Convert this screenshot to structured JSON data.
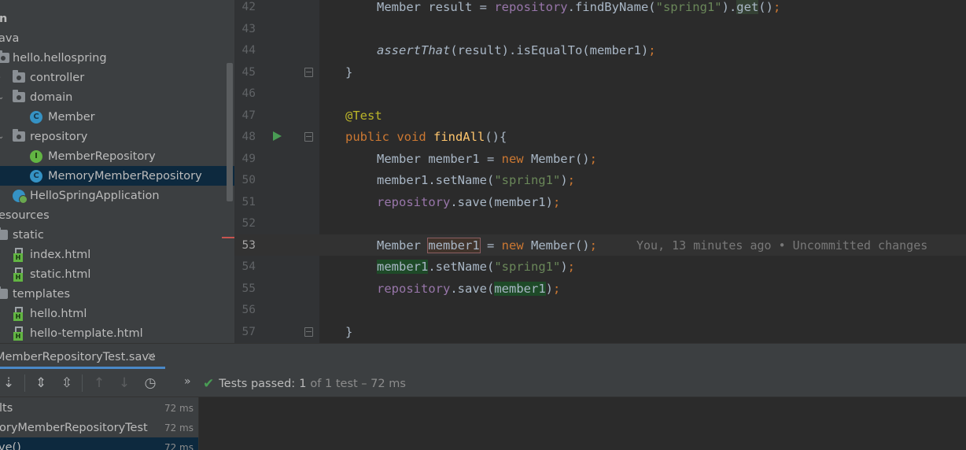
{
  "project_tree": {
    "items": [
      {
        "label": "n",
        "icon": "none"
      },
      {
        "label": "ava",
        "icon": "none"
      },
      {
        "label": "hello.hellospring",
        "icon": "package-icon"
      },
      {
        "label": "controller",
        "icon": "package-icon"
      },
      {
        "label": "domain",
        "icon": "package-icon"
      },
      {
        "label": "Member",
        "icon": "class-icon",
        "badge": "C"
      },
      {
        "label": "repository",
        "icon": "package-icon"
      },
      {
        "label": "MemberRepository",
        "icon": "interface-icon",
        "badge": "I"
      },
      {
        "label": "MemoryMemberRepository",
        "icon": "class-icon",
        "badge": "C",
        "selected": true
      },
      {
        "label": "HelloSpringApplication",
        "icon": "spring-boot-app-icon"
      },
      {
        "label": "esources",
        "icon": "none"
      },
      {
        "label": "static",
        "icon": "folder-icon"
      },
      {
        "label": "index.html",
        "icon": "html-file-icon",
        "badge": "H"
      },
      {
        "label": "static.html",
        "icon": "html-file-icon",
        "badge": "H"
      },
      {
        "label": "templates",
        "icon": "folder-icon"
      },
      {
        "label": "hello.html",
        "icon": "html-file-icon",
        "badge": "H"
      },
      {
        "label": "hello-template.html",
        "icon": "html-file-icon",
        "badge": "H"
      }
    ]
  },
  "editor": {
    "lines": [
      {
        "num": "42",
        "text": "Member result = repository.findByName(\"spring1\").get();"
      },
      {
        "num": "43",
        "text": ""
      },
      {
        "num": "44",
        "text": "assertThat(result).isEqualTo(member1);"
      },
      {
        "num": "45",
        "text": "}"
      },
      {
        "num": "46",
        "text": ""
      },
      {
        "num": "47",
        "text": "@Test"
      },
      {
        "num": "48",
        "text": "public void findAll(){"
      },
      {
        "num": "49",
        "text": "Member member1 = new Member();"
      },
      {
        "num": "50",
        "text": "member1.setName(\"spring1\");"
      },
      {
        "num": "51",
        "text": "repository.save(member1);"
      },
      {
        "num": "52",
        "text": ""
      },
      {
        "num": "53",
        "text": "Member member1 = new Member();"
      },
      {
        "num": "54",
        "text": "member1.setName(\"spring1\");"
      },
      {
        "num": "55",
        "text": "repository.save(member1);"
      },
      {
        "num": "56",
        "text": ""
      },
      {
        "num": "57",
        "text": "}"
      }
    ],
    "blame_annotation": "You, 13 minutes ago • Uncommitted changes",
    "current_line": "53"
  },
  "run_panel": {
    "tab_label": "MemberRepositoryTest.save",
    "tab_close": "×",
    "status": {
      "label": "Tests passed:",
      "count": "1",
      "rest": "of 1 test – 72 ms"
    },
    "results": [
      {
        "label": "lts",
        "time": "72 ms"
      },
      {
        "label": "oryMemberRepositoryTest",
        "time": "72 ms"
      },
      {
        "label": "ve()",
        "time": "72 ms",
        "selected": true
      }
    ]
  },
  "colors": {
    "keyword": "#cc7832",
    "field": "#9876aa",
    "string": "#6a8759",
    "annotation": "#bbb529",
    "method_decl": "#ffc66d",
    "passed": "#499c54",
    "selection": "#0d293e"
  }
}
